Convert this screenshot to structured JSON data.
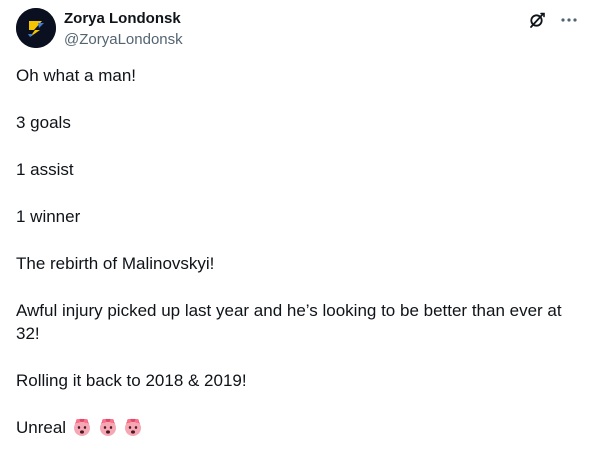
{
  "author": {
    "display_name": "Zorya Londonsk",
    "handle": "@ZoryaLondonsk",
    "avatar_icon": "zorya-logo-icon"
  },
  "actions": {
    "grok_icon": "grok-icon",
    "more_icon": "more-dots-icon"
  },
  "tweet": {
    "lines": [
      "Oh what a man!",
      "3 goals",
      "1 assist",
      "1 winner",
      "The rebirth of Malinovskyi!",
      "Awful injury picked up last year and he’s looking to be better than ever at 32!",
      "Rolling it back to 2018 & 2019!"
    ],
    "last_line_text": "Unreal",
    "last_line_emojis": [
      "exploding-head",
      "exploding-head",
      "exploding-head"
    ]
  },
  "colors": {
    "text": "#0f1419",
    "secondary": "#536471",
    "avatar_bg": "#0b1020",
    "logo_yellow": "#f5c400",
    "logo_blue": "#3b7dd8"
  }
}
